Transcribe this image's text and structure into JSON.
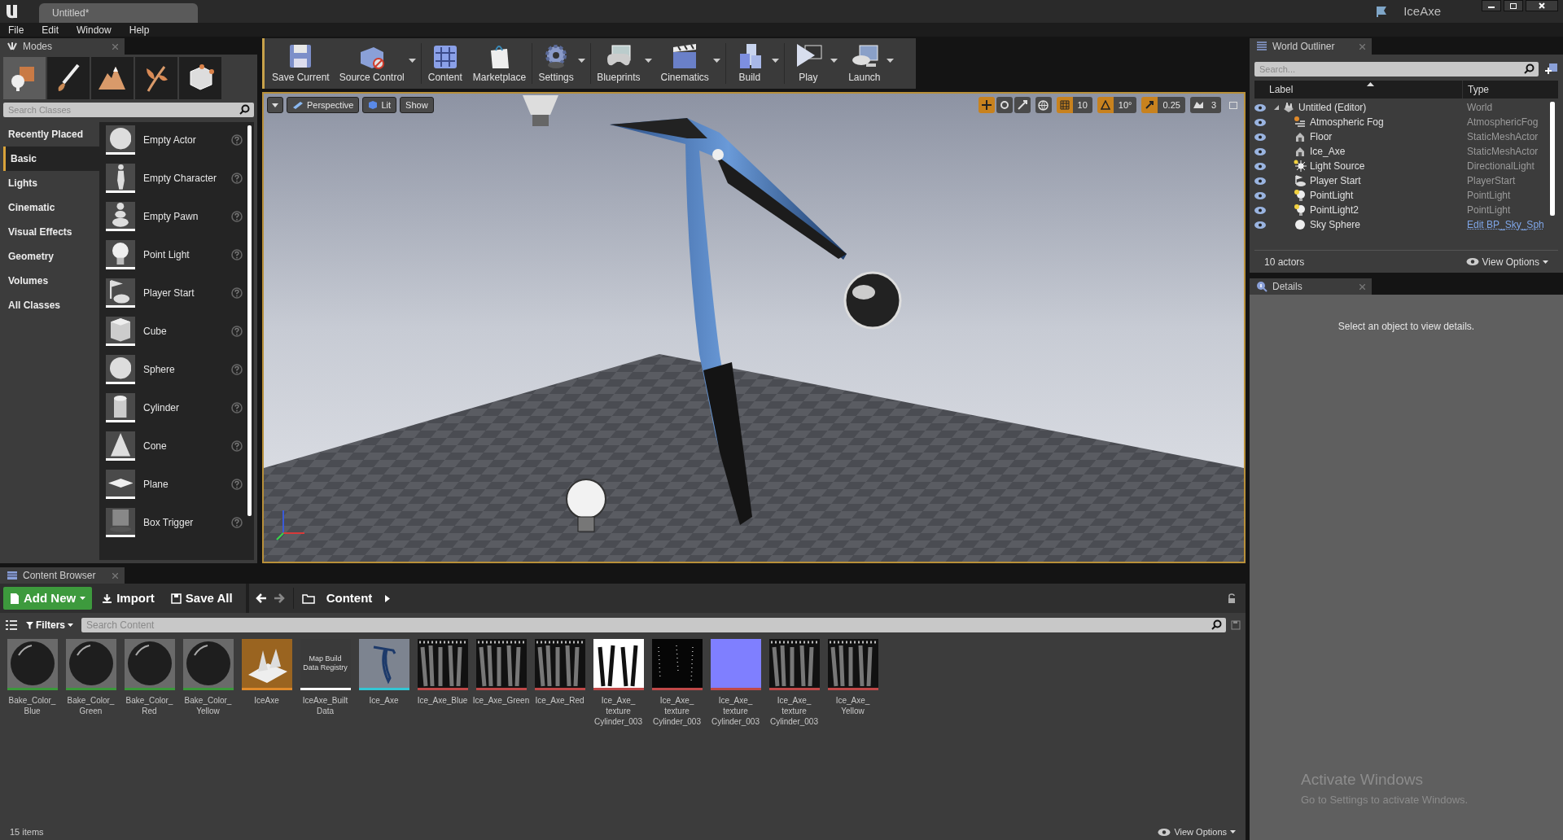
{
  "title_bar": {
    "tab": "Untitled*",
    "project": "IceAxe"
  },
  "menu": [
    "File",
    "Edit",
    "Window",
    "Help"
  ],
  "modes_panel": {
    "tab": "Modes",
    "mode_buttons": [
      {
        "kind": "place",
        "selected": true
      },
      {
        "kind": "paint",
        "selected": false
      },
      {
        "kind": "landscape",
        "selected": false
      },
      {
        "kind": "foliage",
        "selected": false
      },
      {
        "kind": "geometry",
        "selected": false
      }
    ],
    "search": {
      "placeholder": "Search Classes"
    },
    "categories": [
      {
        "label": "Recently Placed",
        "selected": false
      },
      {
        "label": "Basic",
        "selected": true
      },
      {
        "label": "Lights",
        "selected": false
      },
      {
        "label": "Cinematic",
        "selected": false
      },
      {
        "label": "Visual Effects",
        "selected": false
      },
      {
        "label": "Geometry",
        "selected": false
      },
      {
        "label": "Volumes",
        "selected": false
      },
      {
        "label": "All Classes",
        "selected": false
      }
    ],
    "items": [
      {
        "label": "Empty Actor",
        "kind": "sphere"
      },
      {
        "label": "Empty Character",
        "kind": "figure"
      },
      {
        "label": "Empty Pawn",
        "kind": "pawn"
      },
      {
        "label": "Point Light",
        "kind": "bulb"
      },
      {
        "label": "Player Start",
        "kind": "flag"
      },
      {
        "label": "Cube",
        "kind": "cube"
      },
      {
        "label": "Sphere",
        "kind": "sphere"
      },
      {
        "label": "Cylinder",
        "kind": "cylinder"
      },
      {
        "label": "Cone",
        "kind": "cone"
      },
      {
        "label": "Plane",
        "kind": "plane"
      },
      {
        "label": "Box Trigger",
        "kind": "trigger"
      }
    ]
  },
  "toolbar": [
    {
      "label": "Save Current",
      "dropdown": false
    },
    {
      "label": "Source Control",
      "dropdown": true
    },
    {
      "label": "Content",
      "dropdown": false
    },
    {
      "label": "Marketplace",
      "dropdown": false
    },
    {
      "label": "Settings",
      "dropdown": true
    },
    {
      "label": "Blueprints",
      "dropdown": true
    },
    {
      "label": "Cinematics",
      "dropdown": true
    },
    {
      "label": "Build",
      "dropdown": true
    },
    {
      "label": "Play",
      "dropdown": true
    },
    {
      "label": "Launch",
      "dropdown": true
    }
  ],
  "viewport": {
    "buttons": [
      "Perspective",
      "Lit",
      "Show"
    ],
    "snap_values": [
      "10",
      "10°",
      "0.25",
      "3"
    ]
  },
  "world_outliner": {
    "tab": "World Outliner",
    "search": {
      "placeholder": "Search..."
    },
    "columns": [
      "Label",
      "Type"
    ],
    "rows": [
      {
        "label": "Untitled (Editor)",
        "type": "World",
        "kind": "world",
        "visible": true,
        "expanded": true,
        "children": [
          {
            "label": "Atmospheric Fog",
            "type": "AtmosphericFog",
            "kind": "fog",
            "visible": true
          },
          {
            "label": "Floor",
            "type": "StaticMeshActor",
            "kind": "mesh",
            "visible": true
          },
          {
            "label": "Ice_Axe",
            "type": "StaticMeshActor",
            "kind": "mesh",
            "visible": true
          },
          {
            "label": "Light Source",
            "type": "DirectionalLight",
            "kind": "sun",
            "visible": true
          },
          {
            "label": "Player Start",
            "type": "PlayerStart",
            "kind": "start",
            "visible": true
          },
          {
            "label": "PointLight",
            "type": "PointLight",
            "kind": "bulb",
            "visible": true
          },
          {
            "label": "PointLight2",
            "type": "PointLight",
            "kind": "bulb",
            "visible": true
          },
          {
            "label": "Sky Sphere",
            "type": "Edit BP_Sky_Sph",
            "type_is_link": true,
            "kind": "sphere",
            "visible": true
          }
        ]
      }
    ],
    "actor_count": "10 actors",
    "view_options": "View Options"
  },
  "details": {
    "tab": "Details",
    "message": "Select an object to view details."
  },
  "content_browser": {
    "tab": "Content Browser",
    "add_new": "Add New",
    "import": "Import",
    "save_all": "Save All",
    "path": "Content",
    "filters": "Filters",
    "search": {
      "placeholder": "Search Content"
    },
    "assets": [
      {
        "lines": [
          "Bake_Color_",
          "Blue"
        ],
        "kind": "material",
        "color": "#3b9a3b"
      },
      {
        "lines": [
          "Bake_Color_",
          "Green"
        ],
        "kind": "material",
        "color": "#3b9a3b"
      },
      {
        "lines": [
          "Bake_Color_",
          "Red"
        ],
        "kind": "material",
        "color": "#3b9a3b"
      },
      {
        "lines": [
          "Bake_Color_",
          "Yellow"
        ],
        "kind": "material",
        "color": "#3b9a3b"
      },
      {
        "lines": [
          "IceAxe"
        ],
        "kind": "level",
        "color": "#e08a2a"
      },
      {
        "lines": [
          "IceAxe_Built",
          "Data"
        ],
        "kind": "registry",
        "thumb_text": "Map Build Data Registry",
        "color": "#ffffff"
      },
      {
        "lines": [
          "Ice_Axe"
        ],
        "kind": "mesh",
        "color": "#33c6d4"
      },
      {
        "lines": [
          "Ice_Axe_Blue"
        ],
        "kind": "texture",
        "color": "#c04848"
      },
      {
        "lines": [
          "Ice_Axe_Green"
        ],
        "kind": "texture",
        "color": "#c04848"
      },
      {
        "lines": [
          "Ice_Axe_Red"
        ],
        "kind": "texture",
        "color": "#c04848"
      },
      {
        "lines": [
          "Ice_Axe_",
          "texture",
          "Cylinder_003"
        ],
        "kind": "mask",
        "color": "#c04848"
      },
      {
        "lines": [
          "Ice_Axe_",
          "texture",
          "Cylinder_003"
        ],
        "kind": "dark",
        "color": "#c04848"
      },
      {
        "lines": [
          "Ice_Axe_",
          "texture",
          "Cylinder_003"
        ],
        "kind": "normal",
        "color": "#c04848"
      },
      {
        "lines": [
          "Ice_Axe_",
          "texture",
          "Cylinder_003"
        ],
        "kind": "texture",
        "color": "#c04848"
      },
      {
        "lines": [
          "Ice_Axe_",
          "Yellow"
        ],
        "kind": "texture",
        "color": "#c04848"
      }
    ],
    "item_count": "15 items",
    "view_options": "View Options"
  },
  "os_notice": {
    "title": "Activate Windows",
    "text": "Go to Settings to activate Windows."
  }
}
